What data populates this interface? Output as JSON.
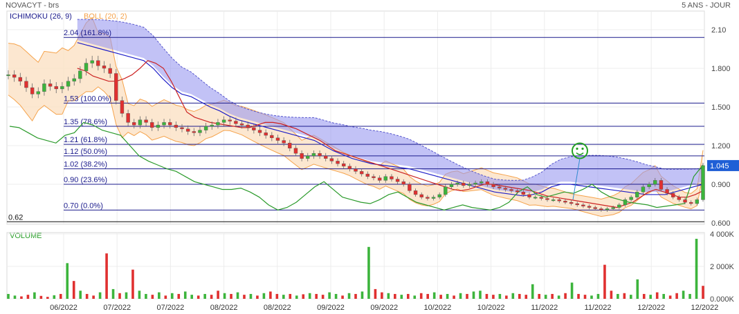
{
  "header": {
    "symbol_label": "NOVACYT - brs",
    "period_label": "5 ANS - JOUR"
  },
  "colors": {
    "cloud_fill": "#9a9af0",
    "boll_fill": "#fbe3c8",
    "boll_line": "#f5a24a",
    "up_candle": "#3cb43c",
    "down_candle": "#e03030",
    "line_green": "#2a9a2a",
    "line_red": "#cc2222",
    "line_blue": "#1e1ec8",
    "fib_line": "#1a1a8c",
    "price_badge": "#1f5fd6",
    "smiley": "#22a022"
  },
  "chart_data": [
    {
      "type": "line",
      "name": "price",
      "legend": [
        {
          "label": "ICHIMOKU (26, 9)",
          "color": "#1a1a8c"
        },
        {
          "label": "BOLL (20, 2)",
          "color": "#f5a24a"
        }
      ],
      "x_ticks": [
        "06/2022",
        "07/2022",
        "07/2022",
        "08/2022",
        "08/2022",
        "09/2022",
        "09/2022",
        "10/2022",
        "10/2022",
        "11/2022",
        "11/2022",
        "12/2022",
        "12/2022"
      ],
      "y_ticks": [
        "2.10",
        "1.800",
        "1.500",
        "1.200",
        "0.900",
        "0.600"
      ],
      "y_tick_values": [
        2.1,
        1.8,
        1.5,
        1.2,
        0.9,
        0.6
      ],
      "ylim": [
        0.6,
        2.1
      ],
      "last_price": "1.045",
      "last_price_value": 1.045,
      "low_marker": "0.62",
      "low_marker_value": 0.62,
      "fibonacci": [
        {
          "label": "2.04  (161.8%)",
          "value": 2.04
        },
        {
          "label": "1.53  (100.0%)",
          "value": 1.53
        },
        {
          "label": "1.35  (78.6%)",
          "value": 1.35
        },
        {
          "label": "1.21  (61.8%)",
          "value": 1.21
        },
        {
          "label": "1.12  (50.0%)",
          "value": 1.12
        },
        {
          "label": "1.02  (38.2%)",
          "value": 1.02
        },
        {
          "label": "0.90  (23.6%)",
          "value": 0.9
        },
        {
          "label": "0.70  (0.0%)",
          "value": 0.7
        }
      ],
      "close": [
        1.75,
        1.73,
        1.7,
        1.65,
        1.6,
        1.62,
        1.68,
        1.66,
        1.64,
        1.66,
        1.7,
        1.72,
        1.78,
        1.84,
        1.86,
        1.82,
        1.8,
        1.76,
        1.55,
        1.45,
        1.38,
        1.36,
        1.4,
        1.38,
        1.34,
        1.36,
        1.38,
        1.36,
        1.34,
        1.33,
        1.31,
        1.3,
        1.32,
        1.35,
        1.36,
        1.38,
        1.4,
        1.39,
        1.37,
        1.36,
        1.34,
        1.32,
        1.3,
        1.28,
        1.26,
        1.24,
        1.22,
        1.18,
        1.14,
        1.1,
        1.12,
        1.14,
        1.12,
        1.1,
        1.08,
        1.06,
        1.04,
        1.02,
        1.0,
        0.98,
        0.96,
        0.95,
        0.93,
        0.96,
        0.94,
        0.92,
        0.9,
        0.85,
        0.82,
        0.8,
        0.79,
        0.8,
        0.82,
        0.88,
        0.9,
        0.91,
        0.89,
        0.9,
        0.91,
        0.92,
        0.9,
        0.88,
        0.87,
        0.86,
        0.85,
        0.84,
        0.82,
        0.8,
        0.8,
        0.79,
        0.78,
        0.78,
        0.77,
        0.76,
        0.75,
        0.74,
        0.73,
        0.72,
        0.71,
        0.7,
        0.71,
        0.72,
        0.74,
        0.78,
        0.8,
        0.84,
        0.88,
        0.9,
        0.93,
        0.86,
        0.83,
        0.8,
        0.78,
        0.76,
        0.75,
        0.78,
        1.045
      ],
      "lagging_span": [
        1.35,
        1.34,
        1.3,
        1.26,
        1.24,
        1.22,
        1.28,
        1.3,
        1.38,
        1.36,
        1.32,
        1.3,
        1.28,
        1.2,
        1.12,
        1.08,
        1.05,
        1.02,
        1.0,
        0.96,
        0.92,
        0.9,
        0.88,
        0.86,
        0.86,
        0.87,
        0.84,
        0.8,
        0.74,
        0.7,
        0.72,
        0.76,
        0.82,
        0.88,
        0.92,
        0.86,
        0.8,
        0.78,
        0.76,
        0.75,
        0.78,
        0.82,
        0.84,
        0.8,
        0.76,
        0.74,
        0.72,
        0.7,
        0.72,
        0.74,
        0.72,
        0.71,
        0.7,
        0.72,
        0.76,
        0.84,
        0.88,
        0.82,
        0.8,
        0.82,
        0.84,
        0.83,
        0.86,
        0.9,
        0.84,
        0.8,
        0.78,
        0.76,
        0.75,
        0.74,
        0.72,
        0.73,
        0.74,
        0.75,
        0.96,
        1.05
      ],
      "tenkan_red": [
        1.8,
        1.78,
        1.74,
        1.72,
        1.7,
        1.7,
        1.72,
        1.75,
        1.8,
        1.86,
        1.84,
        1.8,
        1.7,
        1.58,
        1.46,
        1.42,
        1.4,
        1.38,
        1.37,
        1.36,
        1.35,
        1.34,
        1.34,
        1.36,
        1.38,
        1.38,
        1.37,
        1.35,
        1.33,
        1.3,
        1.27,
        1.24,
        1.2,
        1.16,
        1.14,
        1.12,
        1.1,
        1.08,
        1.06,
        1.04,
        1.02,
        1.0,
        0.98,
        0.96,
        0.94,
        0.92,
        0.9,
        0.88,
        0.86,
        0.85,
        0.86,
        0.88,
        0.9,
        0.9,
        0.89,
        0.88,
        0.87,
        0.86,
        0.85,
        0.83,
        0.81,
        0.8,
        0.79,
        0.78,
        0.77,
        0.76,
        0.75,
        0.74,
        0.73,
        0.72,
        0.74,
        0.76,
        0.8,
        0.84,
        0.86,
        0.84,
        0.82,
        0.8,
        0.8,
        0.82,
        0.85
      ],
      "kijun_blue": [
        2.0,
        1.98,
        1.96,
        1.94,
        1.92,
        1.9,
        1.88,
        1.86,
        1.8,
        1.72,
        1.65,
        1.6,
        1.58,
        1.54,
        1.5,
        1.47,
        1.43,
        1.4,
        1.38,
        1.36,
        1.34,
        1.32,
        1.3,
        1.28,
        1.26,
        1.24,
        1.2,
        1.16,
        1.13,
        1.1,
        1.08,
        1.06,
        1.05,
        1.04,
        1.03,
        1.02,
        1.0,
        0.98,
        0.96,
        0.94,
        0.92,
        0.9,
        0.88,
        0.86,
        0.84,
        0.83,
        0.82,
        0.81,
        0.82,
        0.84,
        0.88,
        0.9,
        0.9,
        0.89,
        0.88,
        0.87,
        0.86,
        0.85,
        0.84,
        0.83,
        0.82,
        0.82,
        0.82,
        0.84,
        0.86,
        0.88,
        0.9
      ]
    },
    {
      "type": "bar",
      "name": "volume",
      "title": "VOLUME",
      "y_ticks": [
        "4 000K",
        "2 000K",
        "0.000K"
      ],
      "y_tick_values": [
        4000,
        2000,
        0
      ],
      "ylim": [
        0,
        4000
      ],
      "unit": "K",
      "values": [
        300,
        200,
        150,
        250,
        400,
        180,
        120,
        220,
        300,
        2200,
        1100,
        500,
        300,
        200,
        400,
        2800,
        600,
        350,
        400,
        1800,
        500,
        300,
        250,
        400,
        200,
        350,
        300,
        450,
        250,
        200,
        300,
        250,
        500,
        350,
        300,
        400,
        250,
        300,
        200,
        350,
        450,
        300,
        250,
        300,
        200,
        280,
        350,
        300,
        250,
        400,
        300,
        200,
        350,
        300,
        450,
        3200,
        600,
        400,
        350,
        300,
        250,
        300,
        200,
        350,
        300,
        400,
        250,
        300,
        200,
        350,
        300,
        450,
        500,
        300,
        250,
        300,
        200,
        350,
        300,
        250,
        900,
        300,
        250,
        300,
        200,
        350,
        1000,
        300,
        250,
        200,
        300,
        2100,
        500,
        300,
        350,
        250,
        1200,
        300,
        250,
        400,
        300,
        200,
        350,
        500,
        300,
        3700,
        800
      ],
      "up": [
        1,
        1,
        0,
        0,
        1,
        0,
        0,
        1,
        0,
        1,
        0,
        1,
        0,
        0,
        1,
        0,
        1,
        0,
        1,
        0,
        1,
        1,
        0,
        1,
        0,
        1,
        0,
        1,
        1,
        0,
        1,
        0,
        0,
        1,
        0,
        1,
        0,
        1,
        0,
        1,
        0,
        0,
        1,
        0,
        1,
        0,
        1,
        0,
        0,
        1,
        1,
        0,
        1,
        0,
        1,
        1,
        0,
        0,
        1,
        0,
        1,
        0,
        1,
        0,
        0,
        1,
        0,
        1,
        0,
        1,
        0,
        1,
        1,
        0,
        0,
        1,
        0,
        1,
        0,
        0,
        1,
        0,
        1,
        0,
        1,
        0,
        1,
        0,
        0,
        1,
        1,
        0,
        0,
        1,
        0,
        1,
        1,
        0,
        1,
        0,
        1,
        0,
        0,
        1,
        1,
        1
      ]
    }
  ],
  "annotation": {
    "smiley_price": 1.16
  }
}
